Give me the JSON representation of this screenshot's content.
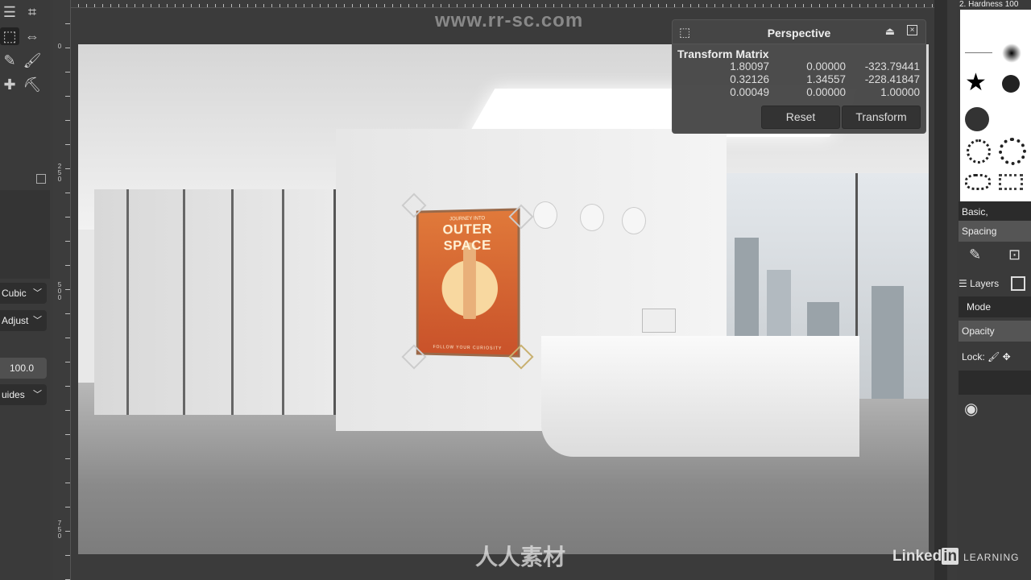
{
  "toolbox": {
    "tools": [
      "align-icon",
      "crop-icon",
      "perspective-icon",
      "flip-icon",
      "pencil-icon",
      "paintbrush-icon",
      "heal-icon",
      "clone-icon"
    ],
    "options": {
      "interpolation": "Cubic",
      "clipping": "Adjust",
      "opacity": "100.0",
      "guides": "uides"
    }
  },
  "rulers": {
    "left_labels": [
      "0",
      "250",
      "500",
      "750"
    ]
  },
  "perspective_dialog": {
    "title": "Perspective",
    "matrix_title": "Transform Matrix",
    "matrix": [
      [
        "1.80097",
        "0.00000",
        "-323.79441"
      ],
      [
        "0.32126",
        "1.34557",
        "-228.41847"
      ],
      [
        "0.00049",
        "0.00000",
        "1.00000"
      ]
    ],
    "reset_label": "Reset",
    "transform_label": "Transform"
  },
  "canvas": {
    "poster": {
      "top": "JOURNEY INTO",
      "title": "OUTER SPACE",
      "bottom": "FOLLOW YOUR CURIOSITY"
    }
  },
  "right_panel": {
    "brush_header": "2. Hardness 100",
    "brush_set": "Basic,",
    "spacing_label": "Spacing",
    "layers_tab": "Layers",
    "mode_label": "Mode",
    "opacity_label": "Opacity",
    "lock_label": "Lock:"
  },
  "watermarks": {
    "site": "www.rr-sc.com",
    "logo_text": "人人素材",
    "linkedin": "Linked",
    "linkedin_in": "in",
    "learning": "LEARNING"
  }
}
